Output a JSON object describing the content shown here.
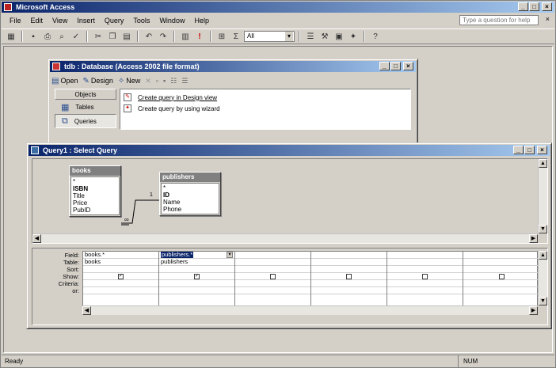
{
  "app": {
    "title": "Microsoft Access",
    "buttons": {
      "minimize": "_",
      "restore": "□",
      "close": "×"
    }
  },
  "menubar": {
    "items": [
      "File",
      "Edit",
      "View",
      "Insert",
      "Query",
      "Tools",
      "Window",
      "Help"
    ],
    "help_placeholder": "Type a question for help"
  },
  "toolbar": {
    "top_values_select": "All",
    "icons": [
      "view-icon",
      "save-icon",
      "print-icon",
      "print-preview-icon",
      "spelling-icon",
      "cut-icon",
      "copy-icon",
      "paste-icon",
      "undo-icon",
      "redo-icon",
      "query-type-icon",
      "run-icon",
      "show-table-icon",
      "totals-icon",
      "top-values-select",
      "properties-icon",
      "build-icon",
      "database-window-icon",
      "new-object-icon",
      "help-icon"
    ]
  },
  "database_window": {
    "title": "tdb : Database (Access 2002 file format)",
    "toolbar": {
      "open": "Open",
      "design": "Design",
      "new": "New"
    },
    "objects_header": "Objects",
    "objects": [
      {
        "label": "Tables",
        "selected": false
      },
      {
        "label": "Queries",
        "selected": true
      }
    ],
    "list_items": [
      "Create query in Design view",
      "Create query by using wizard"
    ]
  },
  "query_window": {
    "title": "Query1 : Select Query",
    "tables": [
      {
        "name": "books",
        "fields": [
          "*",
          "ISBN",
          "Title",
          "Price",
          "PubID"
        ],
        "key_field": "ISBN"
      },
      {
        "name": "publishers",
        "fields": [
          "*",
          "ID",
          "Name",
          "Phone"
        ],
        "key_field": "ID"
      }
    ],
    "join_markers": {
      "one": "1",
      "many": "∞"
    },
    "grid": {
      "row_labels": [
        "Field:",
        "Table:",
        "Sort:",
        "Show:",
        "Criteria:",
        "or:"
      ],
      "columns": [
        {
          "field": "books.*",
          "table": "books",
          "sort": "",
          "show": true
        },
        {
          "field": "publishers.*",
          "table": "publishers",
          "sort": "",
          "show": true
        },
        {
          "field": "",
          "table": "",
          "sort": "",
          "show": false
        },
        {
          "field": "",
          "table": "",
          "sort": "",
          "show": false
        },
        {
          "field": "",
          "table": "",
          "sort": "",
          "show": false
        },
        {
          "field": "",
          "table": "",
          "sort": "",
          "show": false
        }
      ]
    }
  },
  "statusbar": {
    "status": "Ready",
    "num": "NUM"
  }
}
